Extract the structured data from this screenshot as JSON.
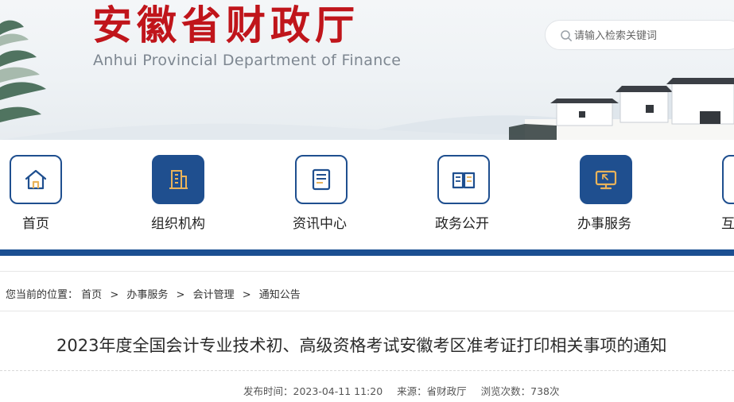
{
  "header": {
    "logo_cn": "安徽省财政厅",
    "logo_en": "Anhui Provincial Department of Finance",
    "search": {
      "placeholder": "请输入检索关键词",
      "icon": "search-icon"
    }
  },
  "nav": {
    "items": [
      {
        "label": "首页",
        "icon": "home-icon"
      },
      {
        "label": "组织机构",
        "icon": "building-icon"
      },
      {
        "label": "资讯中心",
        "icon": "document-icon"
      },
      {
        "label": "政务公开",
        "icon": "open-book-icon"
      },
      {
        "label": "办事服务",
        "icon": "monitor-cursor-icon"
      },
      {
        "label": "互",
        "icon": "interaction-icon"
      }
    ]
  },
  "breadcrumb": {
    "prefix": "您当前的位置：",
    "items": [
      "首页",
      "办事服务",
      "会计管理",
      "通知公告"
    ],
    "separator": ">"
  },
  "article": {
    "title": "2023年度全国会计专业技术初、高级资格考试安徽考区准考证打印相关事项的通知",
    "publish_label": "发布时间：",
    "publish_time": "2023-04-11 11:20",
    "source_label": "来源：",
    "source": "省财政厅",
    "views_label": "浏览次数：",
    "views": "738次"
  },
  "colors": {
    "brand_red": "#c0151b",
    "brand_blue": "#1b4f92",
    "icon_gold": "#e9b35a"
  }
}
